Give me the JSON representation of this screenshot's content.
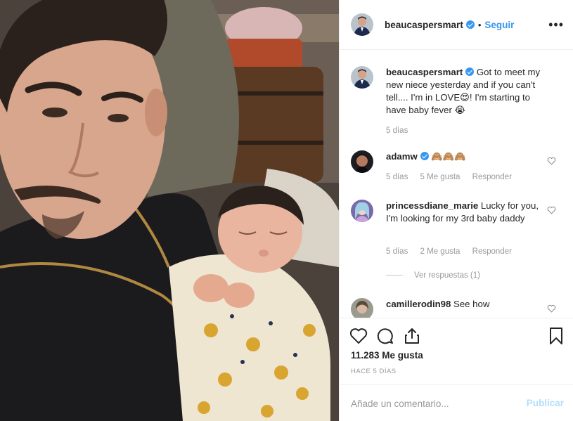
{
  "header": {
    "username": "beaucaspersmart",
    "separator": "•",
    "follow_label": "Seguir",
    "more_icon": "more-options-icon"
  },
  "caption": {
    "username": "beaucaspersmart",
    "text_part1": "Got to meet my new niece yesterday and if you can't tell.... I'm in LOVE",
    "emoji1": "😍",
    "text_part2": "! I'm starting to have baby fever",
    "emoji2": "😭",
    "time": "5 días"
  },
  "comments": [
    {
      "username": "adamw",
      "verified": true,
      "text": "🙈🙈🙈",
      "time": "5 días",
      "likes": "5 Me gusta",
      "reply": "Responder"
    },
    {
      "username": "princessdiane_marie",
      "verified": false,
      "text": "Lucky for you, I'm looking for my 3rd baby daddy",
      "time": "5 días",
      "likes": "2 Me gusta",
      "reply": "Responder",
      "view_replies": "Ver respuestas (1)"
    },
    {
      "username": "camillerodin98",
      "verified": false,
      "text": "See how"
    }
  ],
  "actions": {
    "likes": "11.283 Me gusta",
    "posted": "HACE 5 DÍAS"
  },
  "add_comment": {
    "placeholder": "Añade un comentario...",
    "publish_label": "Publicar"
  },
  "colors": {
    "link_blue": "#3897f0",
    "publish_disabled": "#b2dffc",
    "muted": "#999999"
  }
}
